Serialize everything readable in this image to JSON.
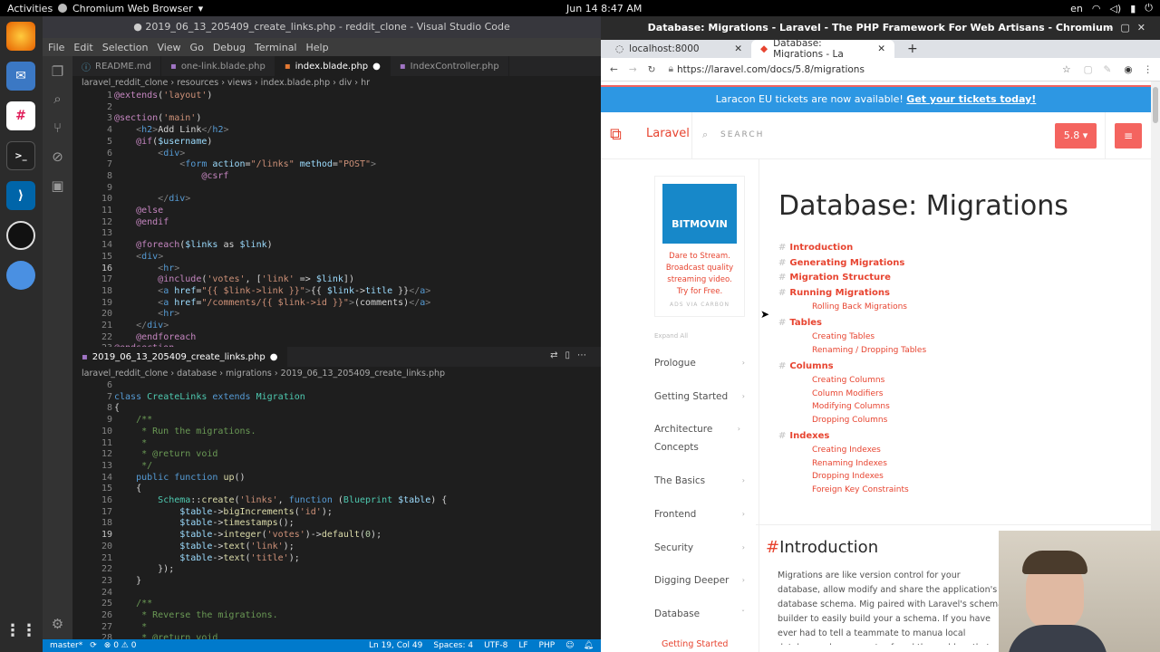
{
  "topbar": {
    "activities": "Activities",
    "app": "Chromium Web Browser",
    "clock": "Jun 14  8:47 AM",
    "lang": "en"
  },
  "vscode": {
    "title": "● 2019_06_13_205409_create_links.php - reddit_clone - Visual Studio Code",
    "menu": [
      "File",
      "Edit",
      "Selection",
      "View",
      "Go",
      "Debug",
      "Terminal",
      "Help"
    ],
    "tabs": [
      "README.md",
      "one-link.blade.php",
      "index.blade.php",
      "IndexController.php"
    ],
    "breadcrumb1": "laravel_reddit_clone › resources › views › index.blade.php › div › hr",
    "tab2": "2019_06_13_205409_create_links.php",
    "breadcrumb2": "laravel_reddit_clone › database › migrations › 2019_06_13_205409_create_links.php",
    "status": {
      "branch": "master*",
      "problems": "⊗ 0 ⚠ 0",
      "position": "Ln 19, Col 49",
      "spaces": "Spaces: 4",
      "encoding": "UTF-8",
      "eol": "LF",
      "lang": "PHP"
    }
  },
  "chromium": {
    "title": "Database: Migrations - Laravel - The PHP Framework For Web Artisans - Chromium",
    "tab1": "localhost:8000",
    "tab2": "Database: Migrations - La",
    "url": "https://laravel.com/docs/5.8/migrations",
    "banner": "Laracon EU tickets are now available!",
    "banner_link": "Get your tickets today!",
    "logo": "Laravel",
    "search": "SEARCH",
    "version": "5.8",
    "ad": {
      "brand": "BITMOVIN",
      "text": "Dare to Stream. Broadcast quality streaming video. Try for Free.",
      "via": "ADS VIA CARBON"
    },
    "expand": "Expand All",
    "nav": [
      "Prologue",
      "Getting Started",
      "Architecture Concepts",
      "The Basics",
      "Frontend",
      "Security",
      "Digging Deeper",
      "Database"
    ],
    "nav_sub": "Getting Started",
    "h1": "Database: Migrations",
    "toc": [
      {
        "label": "Introduction",
        "sub": []
      },
      {
        "label": "Generating Migrations",
        "sub": []
      },
      {
        "label": "Migration Structure",
        "sub": []
      },
      {
        "label": "Running Migrations",
        "sub": [
          "Rolling Back Migrations"
        ]
      },
      {
        "label": "Tables",
        "sub": [
          "Creating Tables",
          "Renaming / Dropping Tables"
        ]
      },
      {
        "label": "Columns",
        "sub": [
          "Creating Columns",
          "Column Modifiers",
          "Modifying Columns",
          "Dropping Columns"
        ]
      },
      {
        "label": "Indexes",
        "sub": [
          "Creating Indexes",
          "Renaming Indexes",
          "Dropping Indexes",
          "Foreign Key Constraints"
        ]
      }
    ],
    "h2": "Introduction",
    "para": "Migrations are like version control for your database, allow modify and share the application's database schema. Mig paired with Laravel's schema builder to easily build your a schema. If you have ever had to tell a teammate to manua local database schema, you've faced the problem that dat"
  }
}
